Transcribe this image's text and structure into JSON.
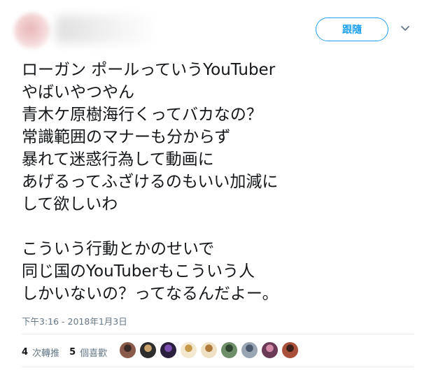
{
  "header": {
    "follow_label": "跟隨",
    "menu_icon": "chevron-down-icon"
  },
  "tweet": {
    "lines": [
      "ローガン ポールっていうYouTuber",
      "やばいやつやん",
      "青木ケ原樹海行くってバカなの？",
      "常識範囲のマナーも分からず",
      "暴れて迷惑行為して動画に",
      "あげるってふざけるのもいい加減に",
      "して欲しいわ",
      "",
      "こういう行動とかのせいで",
      "同じ国のYouTuberもこういう人",
      "しかいないの？ってなるんだよー。"
    ],
    "timestamp": "下午3:16 - 2018年1月3日"
  },
  "stats": {
    "retweets_count": "4",
    "retweets_label": "次轉推",
    "likes_count": "5",
    "likes_label": "個喜歡"
  },
  "likers": [
    {
      "color": "#8a5a4a",
      "accent": "#3b2a25"
    },
    {
      "color": "#2d2d2d",
      "accent": "#c9a36b"
    },
    {
      "color": "#2a1f3d",
      "accent": "#7a4fb0"
    },
    {
      "color": "#f4e9d0",
      "accent": "#c69a4a"
    },
    {
      "color": "#f1e1c4",
      "accent": "#b07a3a"
    },
    {
      "color": "#6e8f6a",
      "accent": "#2e4630"
    },
    {
      "color": "#9aa5b4",
      "accent": "#4b5a6e"
    },
    {
      "color": "#6b3b56",
      "accent": "#d58aa8"
    },
    {
      "color": "#a8503a",
      "accent": "#3a2018"
    }
  ]
}
